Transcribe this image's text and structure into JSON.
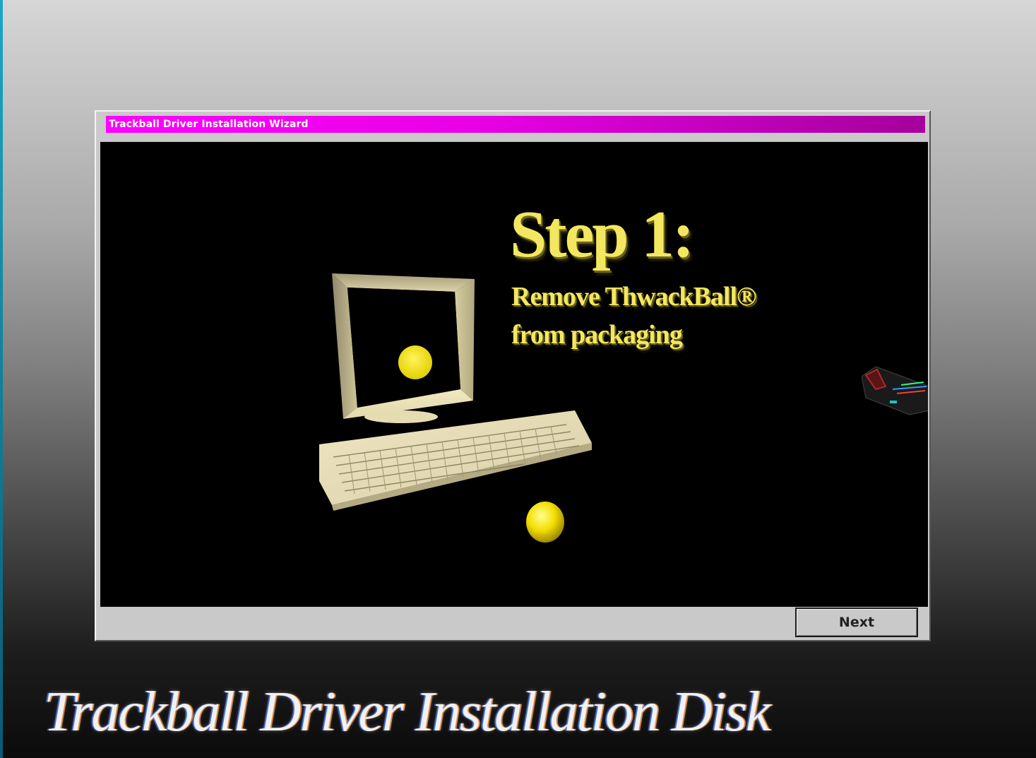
{
  "window": {
    "title": "Trackball Driver Installation Wizard",
    "titlebar_color_start": "#ff00ff",
    "titlebar_color_end": "#a5009c"
  },
  "step": {
    "heading": "Step 1:",
    "line1": "Remove ThwackBall®",
    "line2": "from packaging",
    "text_color": "#f4e760"
  },
  "illustration": {
    "monitor_icon": "crt-monitor-icon",
    "keyboard_icon": "keyboard-icon",
    "ball_icon": "trackball-ball-icon",
    "device_icon": "trackball-device-icon"
  },
  "buttons": {
    "next_label": "Next"
  },
  "caption": {
    "text": "Trackball Driver Installation Disk"
  }
}
